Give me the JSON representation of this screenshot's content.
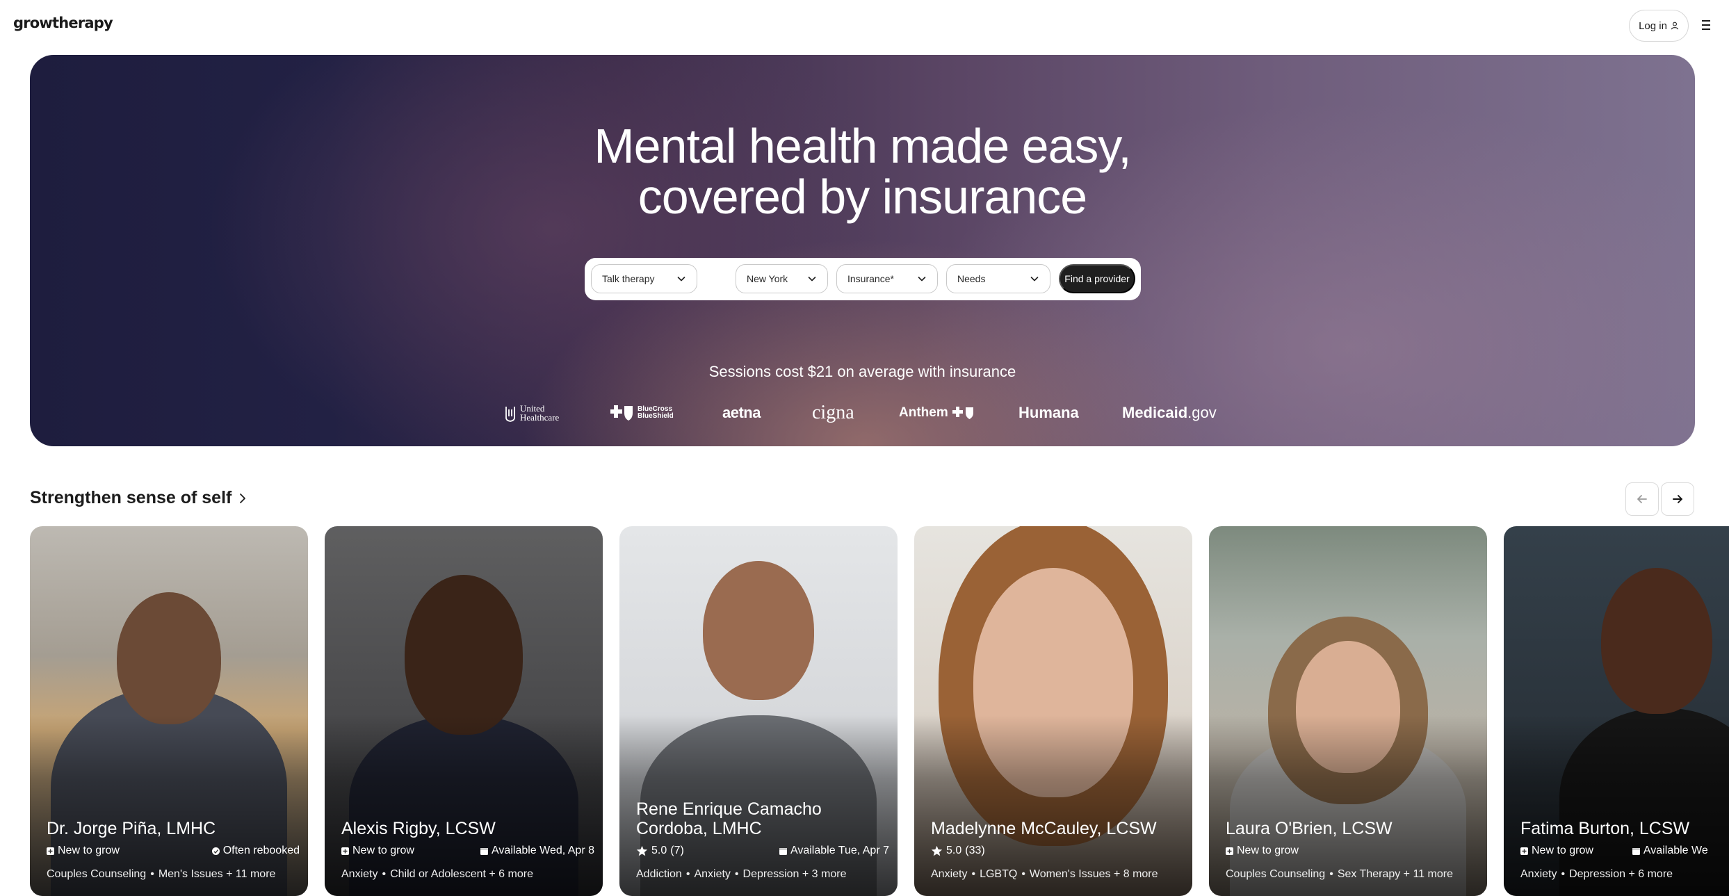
{
  "brand": {
    "logo": "growtherapy"
  },
  "nav": {
    "login_label": "Log in"
  },
  "hero": {
    "title_line1": "Mental health made easy,",
    "title_line2": "covered by insurance",
    "search": {
      "therapy_type": "Talk therapy",
      "state": "New York",
      "insurance_placeholder": "Insurance*",
      "needs_placeholder": "Needs",
      "find_button": "Find a provider"
    },
    "sessions_text": "Sessions cost $21 on average with insurance",
    "insurers": {
      "united_line1": "United",
      "united_line2": "Healthcare",
      "bcbs_line1": "BlueCross",
      "bcbs_line2": "BlueShield",
      "aetna": "aetna",
      "cigna": "cigna",
      "anthem": "Anthem",
      "humana": "Humana",
      "medicaid_bold": "Medicaid",
      "medicaid_light": ".gov"
    }
  },
  "section": {
    "title": "Strengthen sense of self"
  },
  "providers": [
    {
      "name": "Dr. Jorge Piña, LMHC",
      "badge_left": "New to grow",
      "badge_right": "Often rebooked",
      "tags": [
        "Couples Counseling",
        "Men's Issues + 11 more"
      ]
    },
    {
      "name": "Alexis Rigby, LCSW",
      "badge_left": "New to grow",
      "badge_right": "Available Wed, Apr 8",
      "tags": [
        "Anxiety",
        "Child or Adolescent + 6 more"
      ]
    },
    {
      "name_line1": "Rene Enrique Camacho",
      "name_line2": "Cordoba, LMHC",
      "rating": "5.0",
      "rating_count": "(7)",
      "badge_right": "Available Tue, Apr 7",
      "tags": [
        "Addiction",
        "Anxiety",
        "Depression + 3 more"
      ]
    },
    {
      "name": "Madelynne McCauley, LCSW",
      "rating": "5.0",
      "rating_count": "(33)",
      "tags": [
        "Anxiety",
        "LGBTQ",
        "Women's Issues + 8 more"
      ]
    },
    {
      "name": "Laura O'Brien, LCSW",
      "badge_left": "New to grow",
      "tags": [
        "Couples Counseling",
        "Sex Therapy + 11 more"
      ]
    },
    {
      "name": "Fatima Burton, LCSW",
      "badge_left": "New to grow",
      "badge_right": "Available We",
      "tags": [
        "Anxiety",
        "Depression + 6 more"
      ]
    }
  ],
  "icons": {
    "user": "user-icon",
    "menu": "hamburger-menu-icon",
    "chevron": "chevron-down-icon",
    "arrow_left": "arrow-left-icon",
    "arrow_right": "arrow-right-icon",
    "calendar": "calendar-icon",
    "star": "star-icon"
  }
}
